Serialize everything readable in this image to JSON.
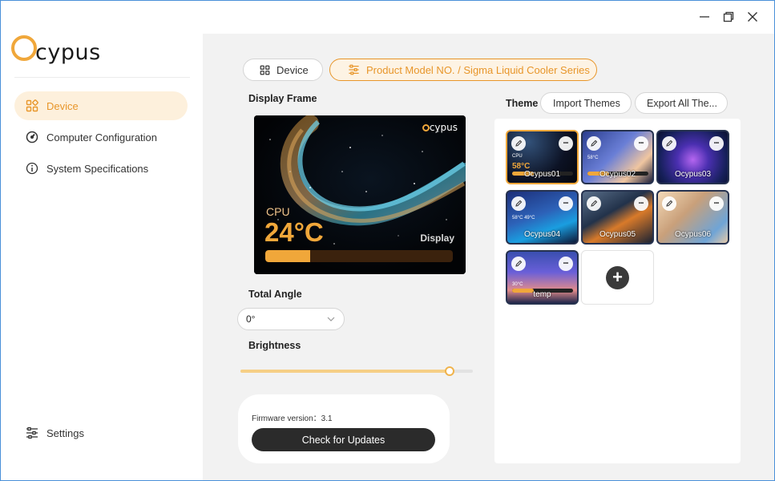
{
  "window": {
    "minimize_icon": "minimize-icon",
    "restore_icon": "restore-icon",
    "close_icon": "close-icon"
  },
  "brand": {
    "logo_text": "cypus",
    "accent": "#f0a73a"
  },
  "sidebar": {
    "items": [
      {
        "label": "Device",
        "icon": "grid-icon",
        "active": true
      },
      {
        "label": "Computer Configuration",
        "icon": "gauge-icon",
        "active": false
      },
      {
        "label": "System Specifications",
        "icon": "info-icon",
        "active": false
      }
    ],
    "settings_label": "Settings"
  },
  "tabs": {
    "device_label": "Device",
    "product_label": "Product Model NO. / Sigma Liquid Cooler Series"
  },
  "display_frame": {
    "label": "Display Frame",
    "brand": "cypus",
    "cpu_label": "CPU",
    "temperature": "24°C",
    "display_label": "Display",
    "bar_fraction": 0.24
  },
  "total_angle": {
    "label": "Total Angle",
    "value": "0°"
  },
  "brightness": {
    "label": "Brightness",
    "value_fraction": 0.9
  },
  "firmware": {
    "label": "Firmware version：3.1",
    "button_label": "Check for Updates"
  },
  "theme": {
    "label": "Theme",
    "import_label": "Import Themes",
    "export_label": "Export All The...",
    "tiles": [
      {
        "name": "Ocypus01",
        "selected": true,
        "big_text": "58°C",
        "small_text": "CPU"
      },
      {
        "name": "Ocypus02",
        "selected": false,
        "big_text": "",
        "small_text": "58°C"
      },
      {
        "name": "Ocypus03",
        "selected": false,
        "big_text": "",
        "small_text": ""
      },
      {
        "name": "Ocypus04",
        "selected": false,
        "big_text": "",
        "small_text": "58°C  49°C"
      },
      {
        "name": "Ocypus05",
        "selected": false,
        "big_text": "",
        "small_text": ""
      },
      {
        "name": "Ocypus06",
        "selected": false,
        "big_text": "",
        "small_text": ""
      },
      {
        "name": "temp",
        "selected": false,
        "big_text": "",
        "small_text": "30°C"
      }
    ],
    "add_label": "+"
  }
}
